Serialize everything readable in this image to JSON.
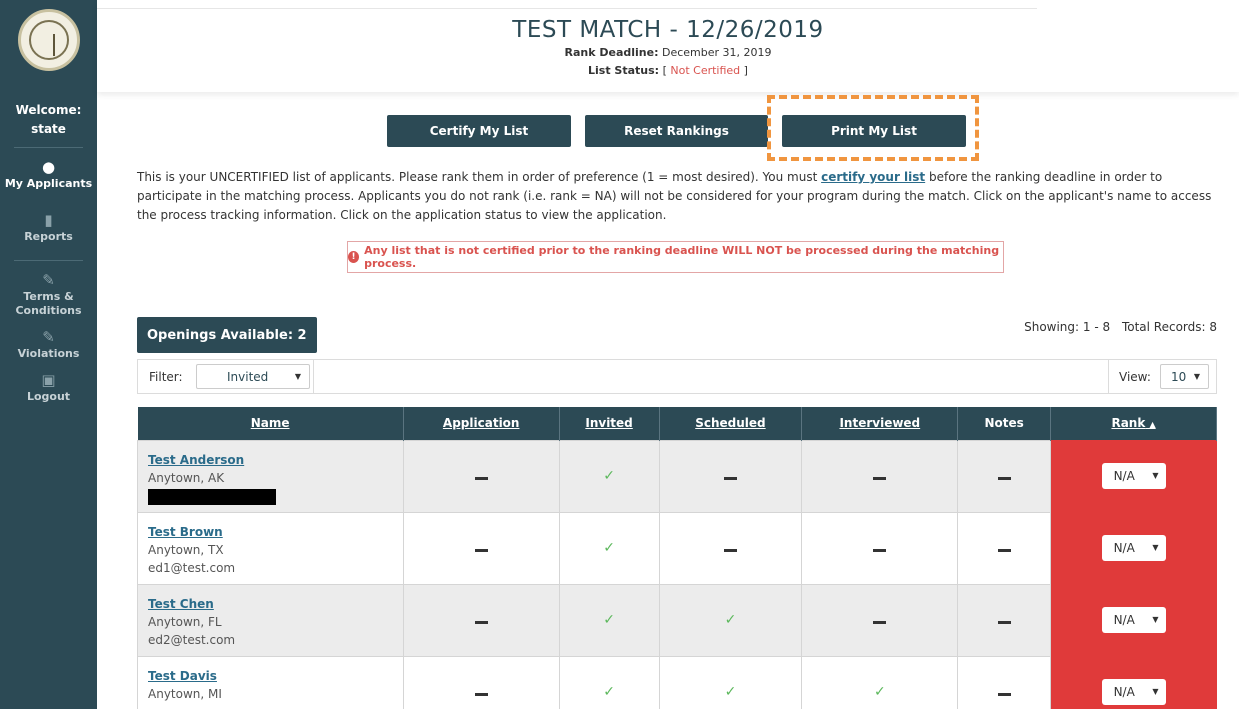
{
  "sidebar": {
    "welcome": "Welcome:",
    "user": "state",
    "items": [
      {
        "label": "My Applicants",
        "icon": "user-icon"
      },
      {
        "label": "Reports",
        "icon": "clipboard-icon"
      },
      {
        "label": "Terms & Conditions",
        "icon": "edit-icon"
      },
      {
        "label": "Violations",
        "icon": "edit-icon"
      },
      {
        "label": "Logout",
        "icon": "door-icon"
      }
    ]
  },
  "header": {
    "title": "TEST MATCH - 12/26/2019",
    "deadline_label": "Rank Deadline:",
    "deadline_value": "December 31, 2019",
    "status_label": "List Status:",
    "status_value": "Not Certified"
  },
  "buttons": {
    "certify": "Certify My List",
    "reset": "Reset Rankings",
    "print": "Print My List"
  },
  "intro": {
    "part1": "This is your UNCERTIFIED list of applicants. Please rank them in order of preference (1 = most desired). You must ",
    "link": "certify your list",
    "part2": " before the ranking deadline in order to participate in the matching process. Applicants you do not rank (i.e. rank = NA) will not be considered for your program during the match. Click on the applicant's name to access the process tracking information. Click on the application status to view the application."
  },
  "alert": "Any list that is not certified prior to the ranking deadline WILL NOT be processed during the matching process.",
  "openings": "Openings Available: 2",
  "showing": "Showing: 1 - 8",
  "total": "Total Records: 8",
  "filter": {
    "label": "Filter:",
    "value": "Invited"
  },
  "view": {
    "label": "View:",
    "value": "10"
  },
  "table": {
    "headers": [
      "Name",
      "Application",
      "Invited",
      "Scheduled",
      "Interviewed",
      "Notes",
      "Rank"
    ],
    "rows": [
      {
        "name": "Test Anderson",
        "location": "Anytown, AK",
        "email": "",
        "application": "dash",
        "invited": "check",
        "scheduled": "dash",
        "interviewed": "dash",
        "notes": "dash",
        "rank": "N/A"
      },
      {
        "name": "Test Brown",
        "location": "Anytown, TX",
        "email": "ed1@test.com",
        "application": "dash",
        "invited": "check",
        "scheduled": "dash",
        "interviewed": "dash",
        "notes": "dash",
        "rank": "N/A"
      },
      {
        "name": "Test Chen",
        "location": "Anytown, FL",
        "email": "ed2@test.com",
        "application": "dash",
        "invited": "check",
        "scheduled": "check",
        "interviewed": "dash",
        "notes": "dash",
        "rank": "N/A"
      },
      {
        "name": "Test Davis",
        "location": "Anytown, MI",
        "email": "",
        "application": "dash",
        "invited": "check",
        "scheduled": "check",
        "interviewed": "check",
        "notes": "dash",
        "rank": "N/A"
      }
    ]
  },
  "colors": {
    "primary": "#2c4a55",
    "alert": "#d9534f",
    "rank_bg": "#e03a3a",
    "highlight": "#f0953f",
    "check": "#5cb85c"
  }
}
